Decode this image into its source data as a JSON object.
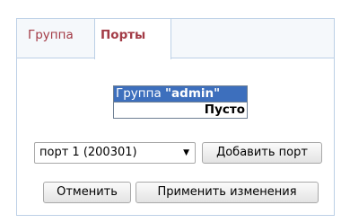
{
  "tabs": [
    {
      "label": "Группа",
      "active": false
    },
    {
      "label": "Порты",
      "active": true
    }
  ],
  "group": {
    "prefix": "Группа",
    "name": "\"admin\"",
    "empty_label": "Пусто"
  },
  "port_select": {
    "selected": "порт 1 (200301)"
  },
  "buttons": {
    "add_port": "Добавить порт",
    "cancel": "Отменить",
    "apply": "Применить изменения"
  },
  "colors": {
    "tab_text": "#a33b46",
    "header_bg": "#3d6fbd",
    "border": "#bcd0e6"
  }
}
